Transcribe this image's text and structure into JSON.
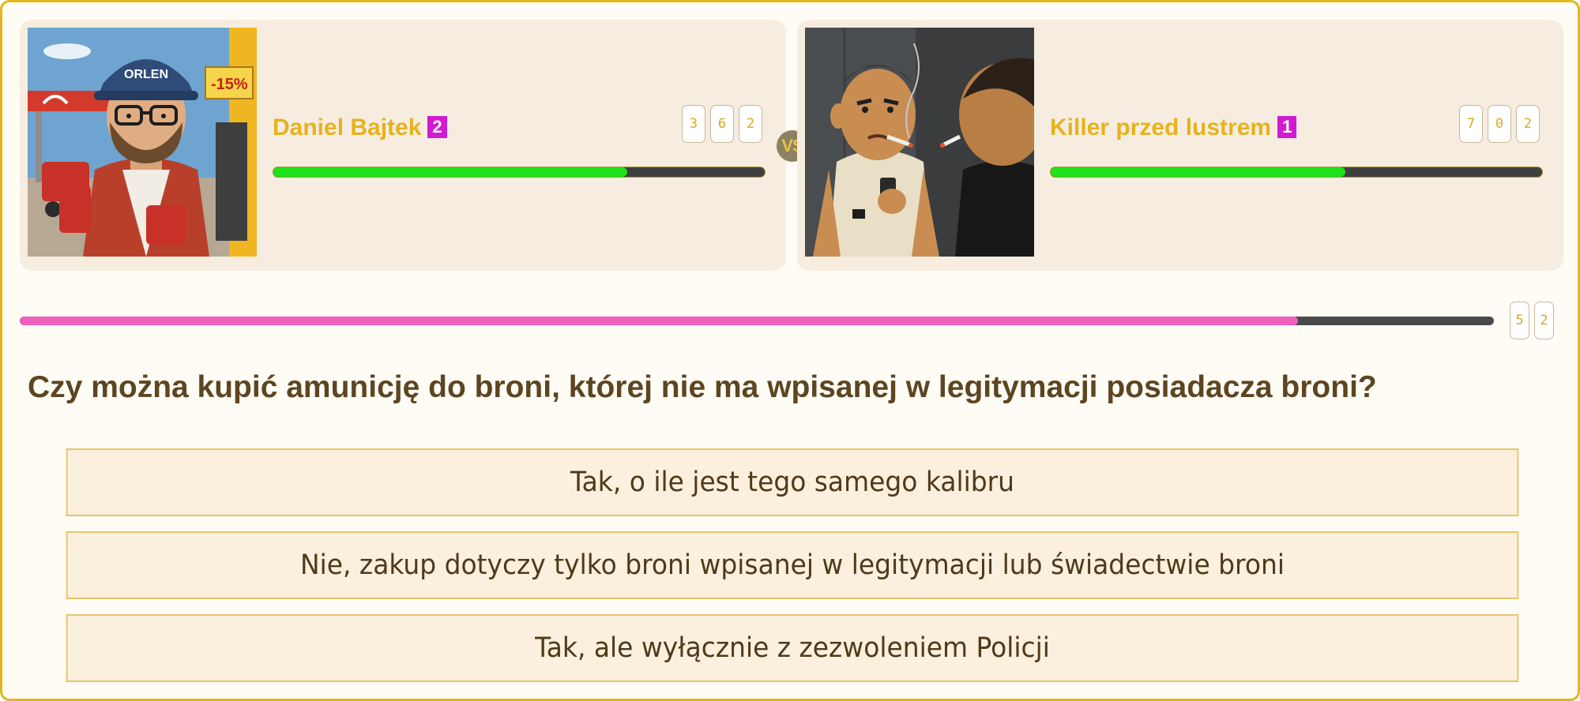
{
  "players": [
    {
      "name": "Daniel Bajtek",
      "rank": "2",
      "score_digits": [
        "3",
        "6",
        "2"
      ],
      "hp_fraction": 0.72,
      "avatar": {
        "cap_text": "ORLEN",
        "sign_text": "-15%"
      }
    },
    {
      "name": "Killer przed lustrem",
      "rank": "1",
      "score_digits": [
        "7",
        "0",
        "2"
      ],
      "hp_fraction": 0.6
    }
  ],
  "vs_label": "VS",
  "timer": {
    "fraction": 0.867,
    "digits": [
      "5",
      "2"
    ]
  },
  "question": "Czy można kupić amunicję do broni, której nie ma wpisanej w legitymacji posiadacza broni?",
  "answers": [
    "Tak, o ile jest tego samego kalibru",
    "Nie, zakup dotyczy tylko broni wpisanej w legitymacji lub świadectwie broni",
    "Tak, ale wyłącznie z zezwoleniem Policji"
  ],
  "colors": {
    "accent": "#e0b81c",
    "player_name": "#e6b21e",
    "rank_badge": "#d21ad2",
    "hp_fill": "#1ee31a",
    "timer_fill": "#f061bd",
    "answer_bg": "#fbefdd"
  }
}
